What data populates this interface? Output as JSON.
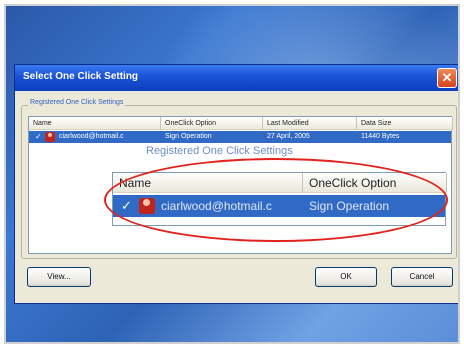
{
  "dialog": {
    "title": "Select One Click Setting",
    "close_glyph": "✕",
    "group_label": "Registered One Click Settings",
    "columns": [
      "Name",
      "OneClick Option",
      "Last Modified",
      "Data Size"
    ],
    "row": {
      "checked": "✓",
      "name": "ciarlwood@hotmail.c",
      "option": "Sign Operation",
      "modified": "27 April, 2005",
      "size": "11440 Bytes"
    },
    "buttons": {
      "view": "View...",
      "ok": "OK",
      "cancel": "Cancel"
    }
  },
  "zoom": {
    "ghost_title": "Registered One Click Settings",
    "columns": [
      "Name",
      "OneClick Option"
    ],
    "row": {
      "checked": "✓",
      "name": "ciarlwood@hotmail.c",
      "option": "Sign Operation"
    }
  },
  "colors": {
    "highlight_oval": "#e0231c",
    "selection": "#316ac5",
    "titlebar": "#0b3fc0"
  },
  "icons": {
    "user": "user-icon",
    "check": "checkmark-icon",
    "close": "close-icon"
  }
}
